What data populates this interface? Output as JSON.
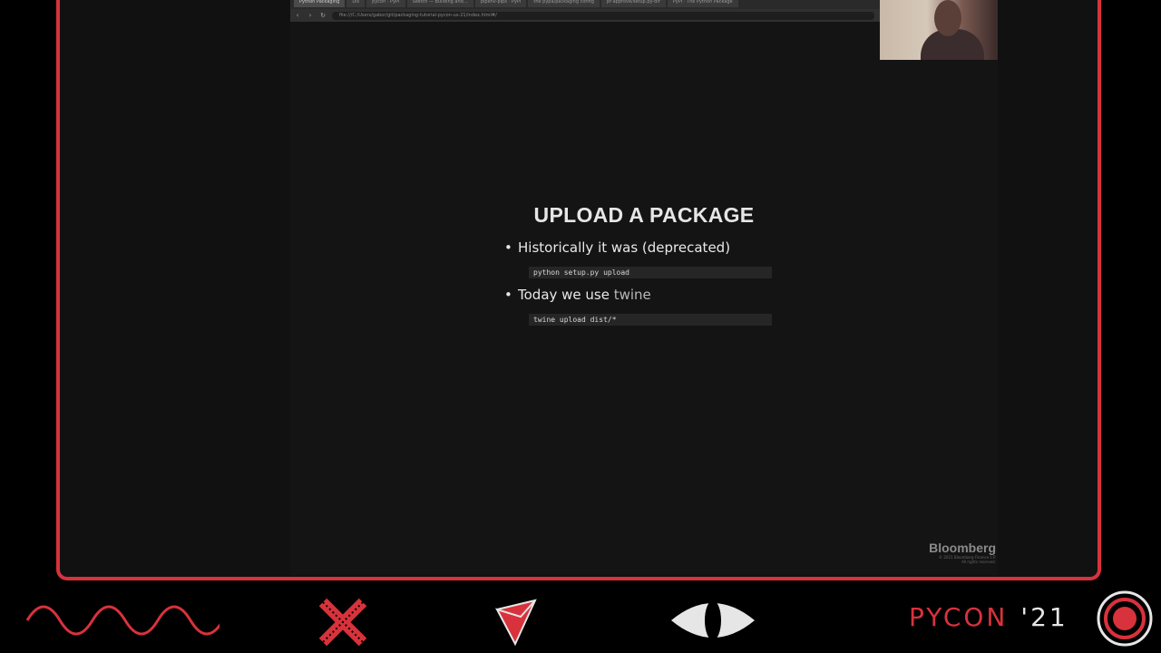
{
  "browser": {
    "tabs": [
      {
        "label": "Python Packaging",
        "active": true
      },
      {
        "label": "Dis"
      },
      {
        "label": "pycon · PyPI"
      },
      {
        "label": "Sketch — Building and…"
      },
      {
        "label": "pipenv-pipx · PyPI"
      },
      {
        "label": "the pypa/packaging config"
      },
      {
        "label": "pr-approve/setup.py-dir"
      },
      {
        "label": "PyPI · The Python Package"
      }
    ],
    "url": "file:///C:/Users/gabor/git/packaging-tutorial-pycon-us-21/index.html#/"
  },
  "slide": {
    "title": "UPLOAD A PACKAGE",
    "bullets": [
      {
        "text": "Historically it was (deprecated)",
        "code": "python setup.py upload"
      },
      {
        "text_prefix": "Today we use ",
        "text_highlight": "twine",
        "code": "twine upload dist/*"
      }
    ],
    "sponsor": {
      "logo": "Bloomberg",
      "fine_line1": "© 2021 Bloomberg Finance L.P.",
      "fine_line2": "All rights reserved."
    }
  },
  "footer": {
    "brand": "PYCON",
    "year": "'21",
    "icons": [
      "wave-icon",
      "x-icon",
      "triangle-icon",
      "eye-icon",
      "target-icon"
    ],
    "accent_color": "#d8323c"
  }
}
